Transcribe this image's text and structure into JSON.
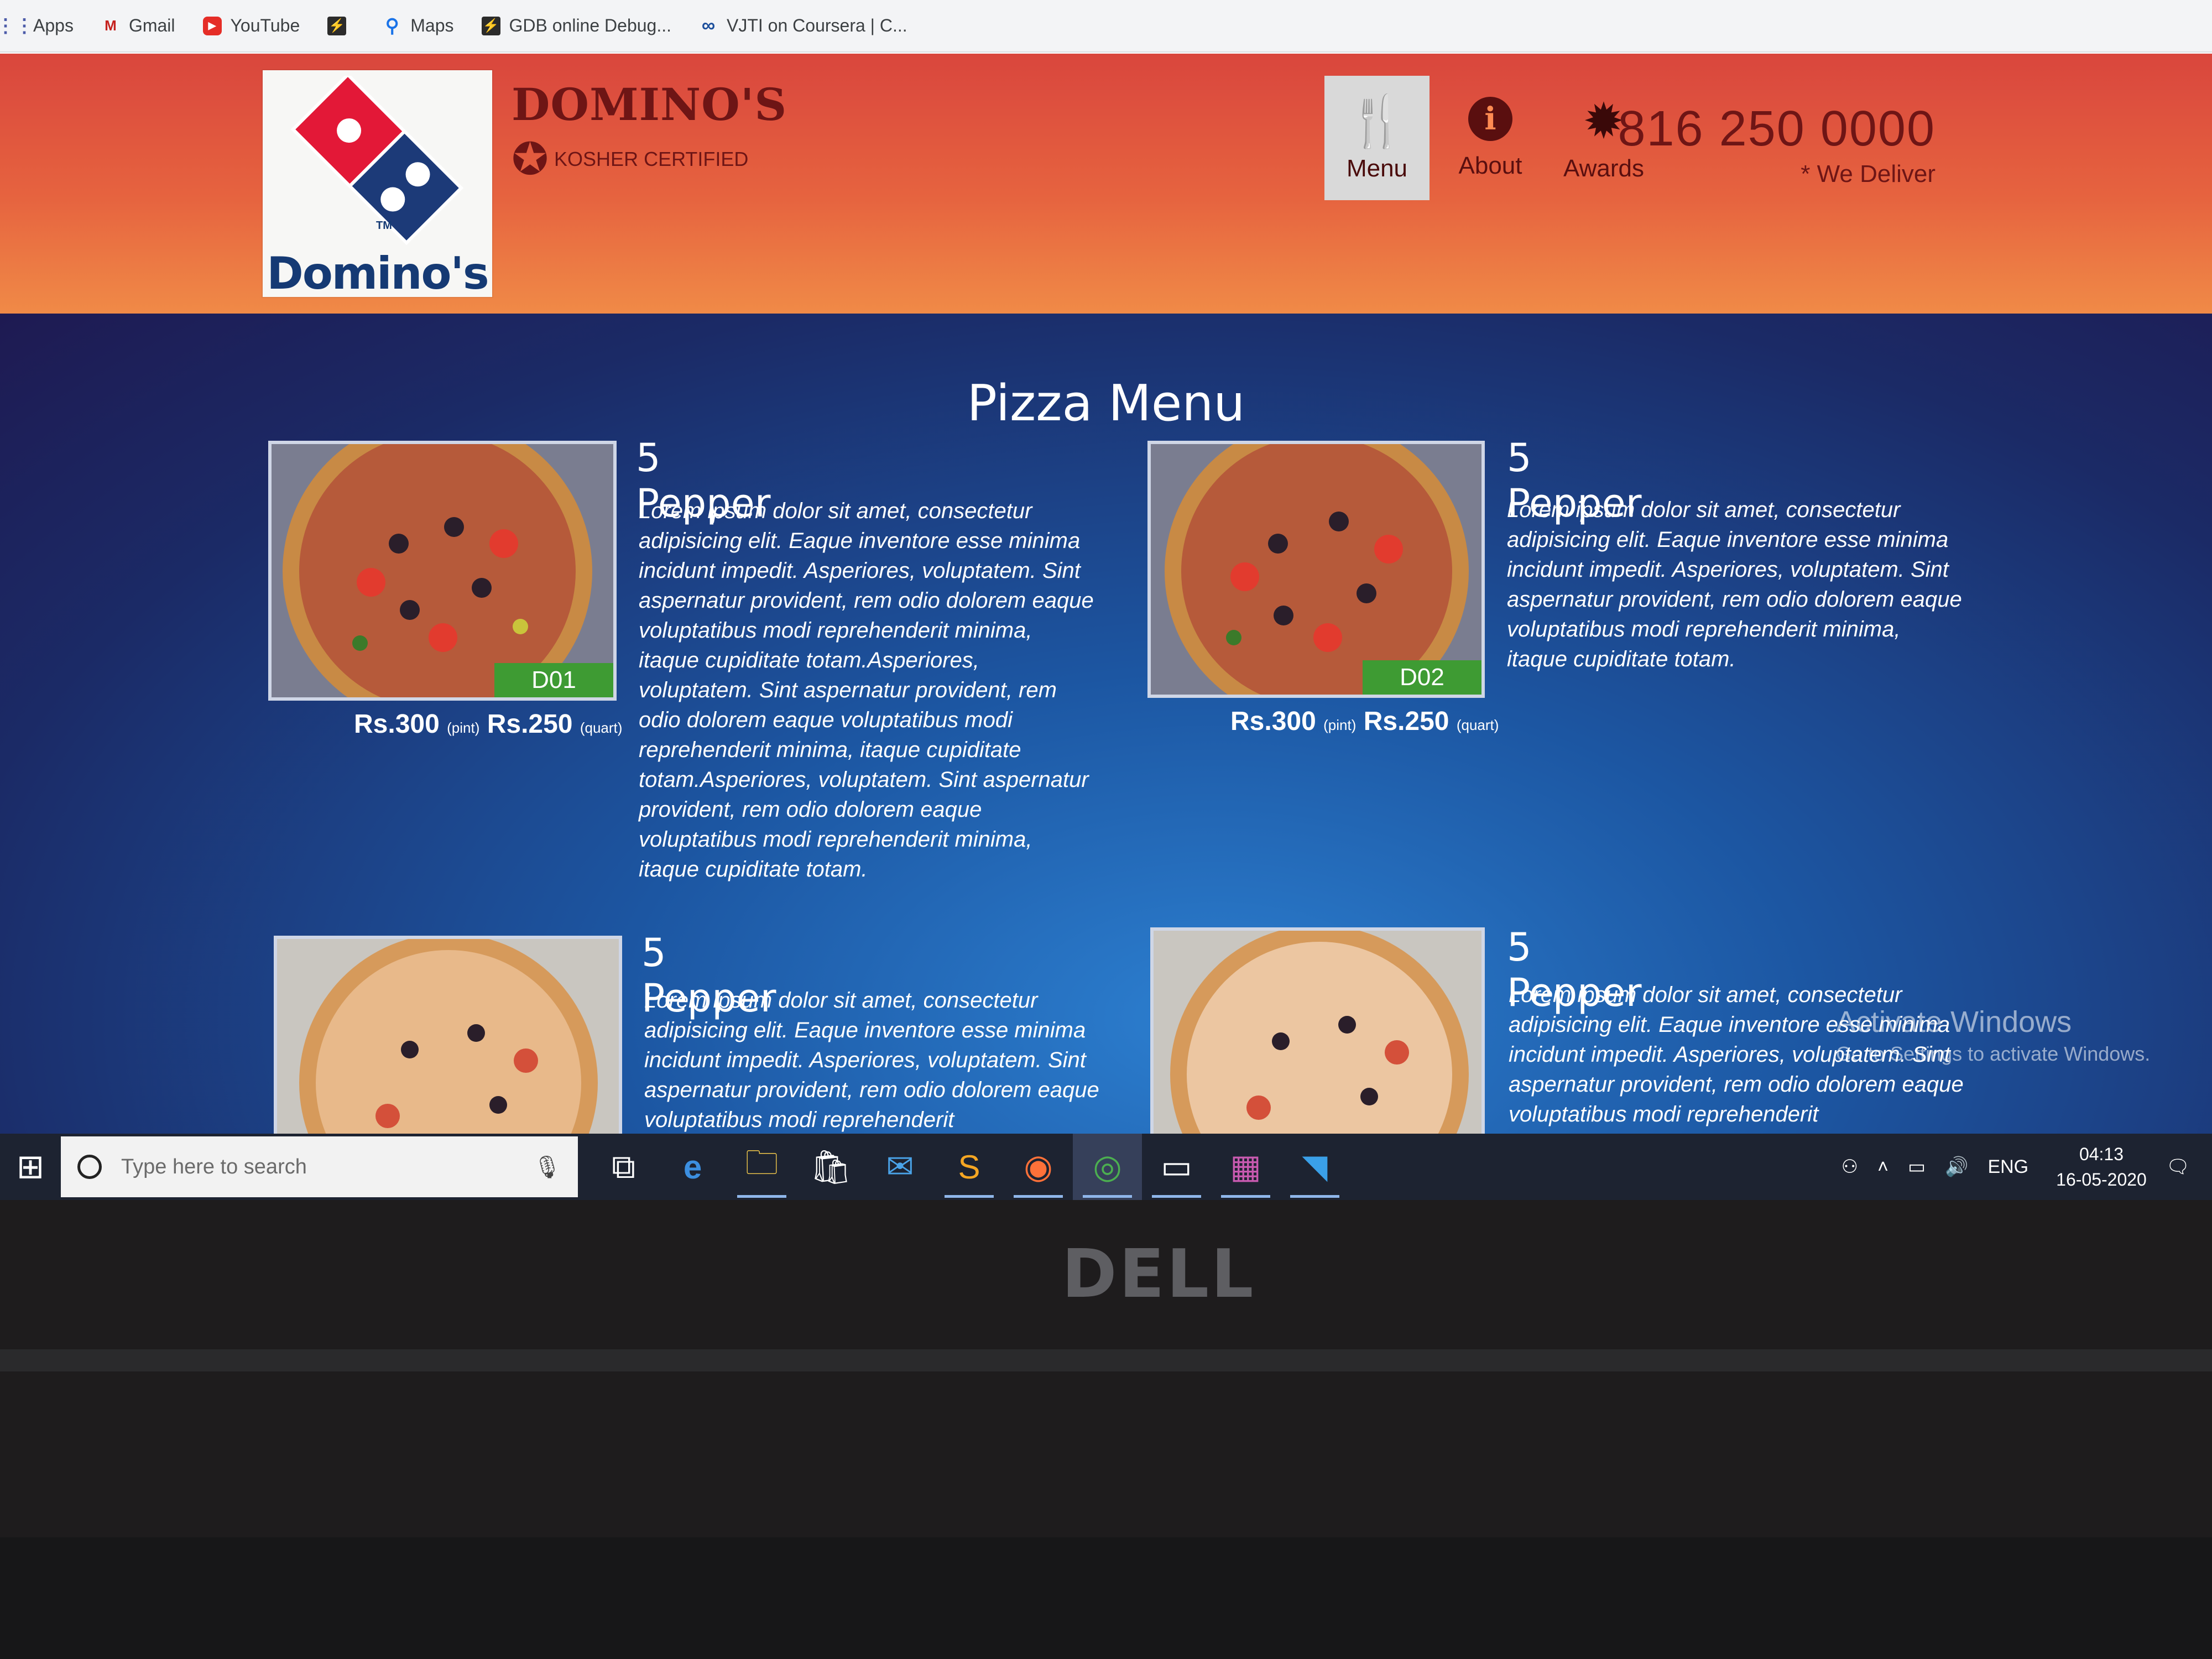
{
  "bookmarks": [
    {
      "label": "Apps",
      "icon": "apps-grid-icon"
    },
    {
      "label": "Gmail",
      "icon": "gmail-icon"
    },
    {
      "label": "YouTube",
      "icon": "youtube-icon"
    },
    {
      "label": "",
      "icon": "bolt-icon"
    },
    {
      "label": "Maps",
      "icon": "maps-pin-icon"
    },
    {
      "label": "GDB online Debug...",
      "icon": "bolt-icon"
    },
    {
      "label": "VJTI on Coursera | C...",
      "icon": "coursera-icon"
    }
  ],
  "header": {
    "logo_text": "Domino's",
    "logo_tm": "TM",
    "brand_name": "DOMINO'S",
    "certification": "KOSHER CERTIFIED",
    "nav": [
      {
        "label": "Menu",
        "icon": "fork-knife-icon",
        "active": true
      },
      {
        "label": "About",
        "icon": "info-icon",
        "active": false
      },
      {
        "label": "Awards",
        "icon": "award-seal-icon",
        "active": false
      }
    ],
    "phone": "816 250 0000",
    "deliver": "* We Deliver"
  },
  "main": {
    "title": "Pizza Menu",
    "items": [
      {
        "title": "5 Pepper",
        "code": "D01",
        "price_pint": "Rs.300",
        "pint_unit": "(pint)",
        "price_quart": "Rs.250",
        "quart_unit": "(quart)",
        "description": "Lorem ipsum dolor sit amet, consectetur adipisicing elit. Eaque inventore esse minima incidunt impedit. Asperiores, voluptatem. Sint aspernatur provident, rem odio dolorem eaque voluptatibus modi reprehenderit minima, itaque cupiditate totam.Asperiores, voluptatem. Sint aspernatur provident, rem odio dolorem eaque voluptatibus modi reprehenderit minima, itaque cupiditate totam.Asperiores, voluptatem. Sint aspernatur provident, rem odio dolorem eaque voluptatibus modi reprehenderit minima, itaque cupiditate totam."
      },
      {
        "title": "5 Pepper",
        "code": "D02",
        "price_pint": "Rs.300",
        "pint_unit": "(pint)",
        "price_quart": "Rs.250",
        "quart_unit": "(quart)",
        "description": "Lorem ipsum dolor sit amet, consectetur adipisicing elit. Eaque inventore esse minima incidunt impedit. Asperiores, voluptatem. Sint aspernatur provident, rem odio dolorem eaque voluptatibus modi reprehenderit minima, itaque cupiditate totam."
      },
      {
        "title": "5 Pepper",
        "description": "Lorem ipsum dolor sit amet, consectetur adipisicing elit. Eaque inventore esse minima incidunt impedit. Asperiores, voluptatem. Sint aspernatur provident, rem odio dolorem eaque voluptatibus modi reprehenderit"
      },
      {
        "title": "5 Pepper",
        "description": "Lorem ipsum dolor sit amet, consectetur adipisicing elit. Eaque inventore esse minima incidunt impedit. Asperiores, voluptatem. Sint aspernatur provident, rem odio dolorem eaque voluptatibus modi reprehenderit"
      }
    ]
  },
  "watermark": {
    "line1": "Activate Windows",
    "line2": "Go to Settings to activate Windows."
  },
  "taskbar": {
    "search_placeholder": "Type here to search",
    "apps": [
      "task-view-icon",
      "edge-icon",
      "file-explorer-icon",
      "store-icon",
      "mail-icon",
      "sublime-icon",
      "firefox-icon",
      "chrome-icon",
      "window-icon",
      "winrar-icon",
      "vscode-icon"
    ],
    "language": "ENG",
    "time": "04:13",
    "date": "16-05-2020"
  },
  "device": {
    "brand": "DELL"
  },
  "colors": {
    "header_top": "#d9463d",
    "header_bottom": "#f08a47",
    "brand_text": "#6e1515",
    "code_tag": "#3e9b33",
    "content_bg": "#1c56a2"
  }
}
